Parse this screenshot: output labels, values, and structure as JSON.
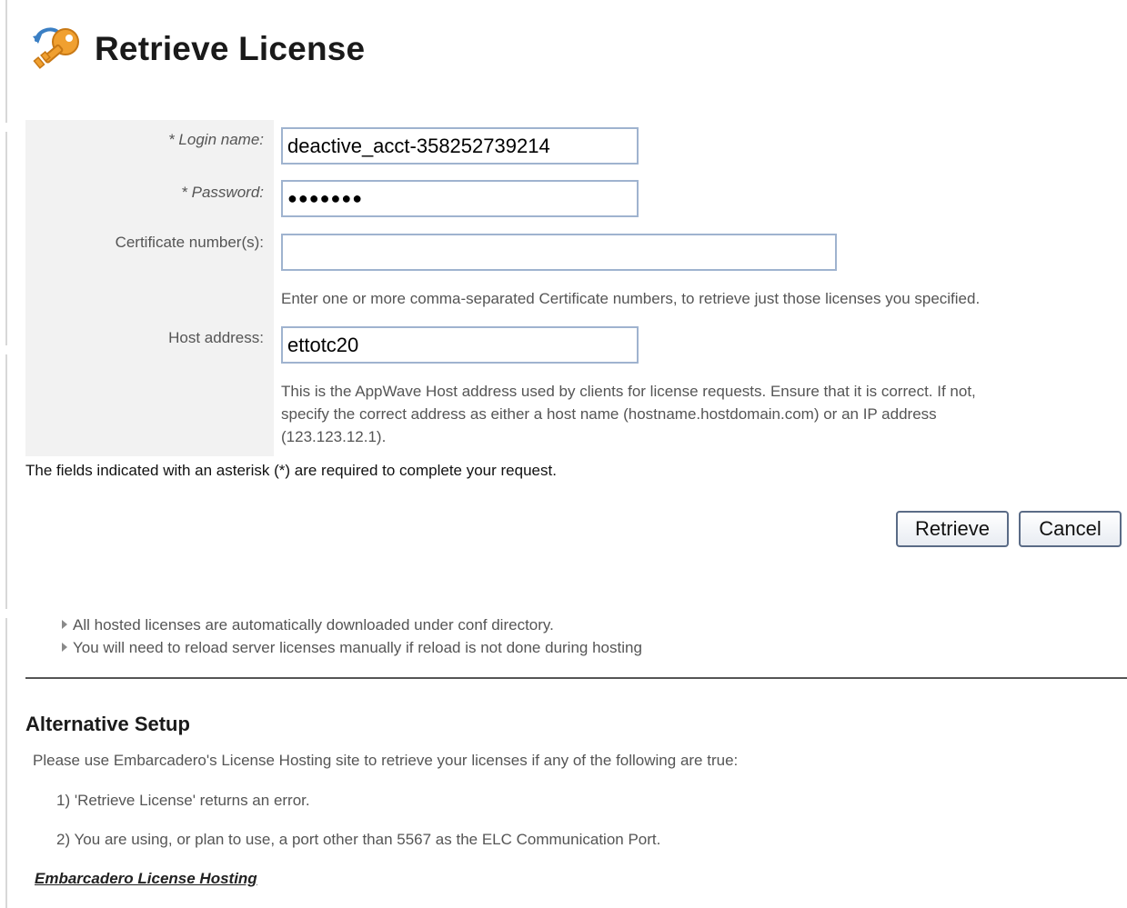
{
  "page": {
    "title": "Retrieve License",
    "icon": "key-icon"
  },
  "form": {
    "login_label": "* Login name:",
    "login_value": "deactive_acct-358252739214",
    "password_label": "* Password:",
    "password_value": "●●●●●●●",
    "certificate_label": "Certificate number(s):",
    "certificate_value": "",
    "certificate_hint": "Enter one or more comma-separated Certificate numbers, to retrieve just those licenses you specified.",
    "host_label": "Host address:",
    "host_value": "ettotc20",
    "host_hint_line1": "This is the AppWave Host address used by clients for license requests. Ensure that it is correct. If not,",
    "host_hint_line2": "specify the correct address as either a host name (hostname.hostdomain.com) or an IP address",
    "host_hint_line3": "(123.123.12.1).",
    "required_note": "The fields indicated with an asterisk (*) are required to complete your request."
  },
  "buttons": {
    "retrieve": "Retrieve",
    "cancel": "Cancel"
  },
  "notes": [
    "All hosted licenses are automatically downloaded under conf directory.",
    "You will need to reload server licenses manually if reload is not done during hosting"
  ],
  "alternative": {
    "heading": "Alternative Setup",
    "intro": "Please use Embarcadero's License Hosting site to retrieve your licenses if any of the following are true:",
    "item1": "1) 'Retrieve License' returns an error.",
    "item2": "2) You are using, or plan to use, a port other than 5567 as the ELC Communication Port.",
    "link": "Embarcadero License Hosting"
  },
  "colors": {
    "input_border": "#9fb3cf",
    "label_bg": "#f2f2f2",
    "key_orange": "#f0a030",
    "arrow_blue": "#3a7fc4"
  }
}
